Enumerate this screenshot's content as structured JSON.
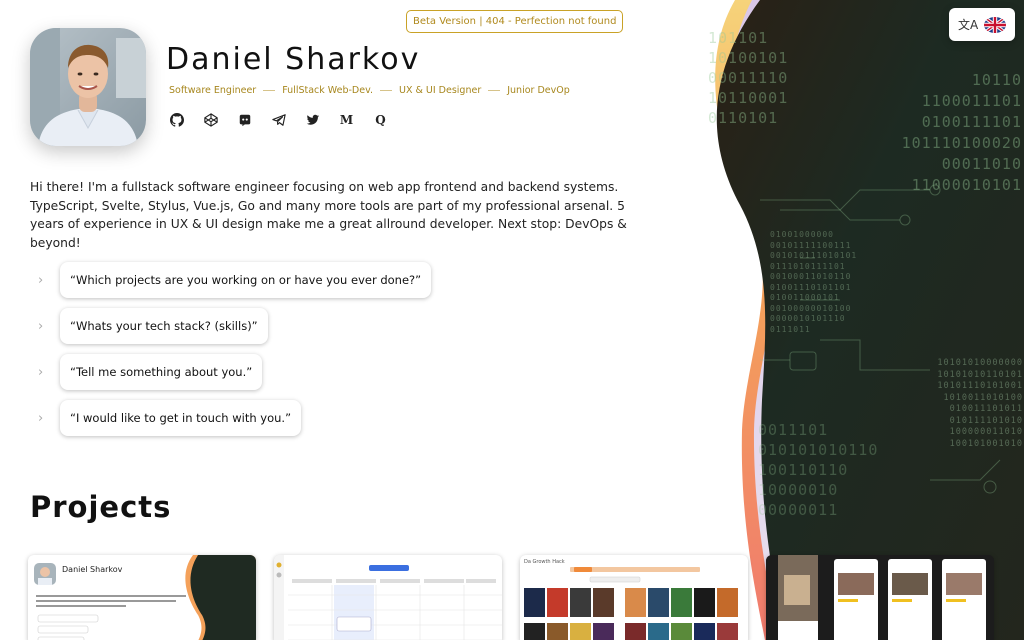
{
  "beta_badge": "Beta Version | 404 - Perfection not found",
  "language": {
    "translate_icon": "translate-icon",
    "flag_icon": "uk-flag-icon"
  },
  "profile": {
    "name": "Daniel Sharkov",
    "roles": [
      "Software Engineer",
      "FullStack Web-Dev.",
      "UX & UI Designer",
      "Junior DevOp"
    ],
    "socials": [
      "github-icon",
      "codepen-icon",
      "discord-icon",
      "telegram-icon",
      "twitter-icon",
      "medium-icon",
      "quora-icon"
    ],
    "social_glyphs": {
      "medium": "M",
      "quora": "Q"
    }
  },
  "intro": "Hi there! I'm a fullstack software engineer focusing on web app frontend and backend systems. TypeScript, Svelte, Stylus, Vue.js, Go and many more tools are part of my professional arsenal. 5 years of experience in UX & UI design make me a great allround developer. Next stop: DevOps & beyond!",
  "questions": [
    "“Which projects are you working on or have you ever done?”",
    "“Whats your tech stack? (skills)”",
    "“Tell me something about you.”",
    "“I would like to get in touch with you.”"
  ],
  "projects_title": "Projects",
  "project_cards": [
    {
      "preview_title": "Daniel Sharkov"
    },
    {
      "preview_title": ""
    },
    {
      "preview_title": "Da Growth Hack"
    },
    {
      "preview_title": ""
    }
  ],
  "colors": {
    "gold": "#b08a1e",
    "dark_panel": "#1e2a20",
    "wave_orange": "#f08a3a",
    "wave_pink": "#f07878"
  }
}
